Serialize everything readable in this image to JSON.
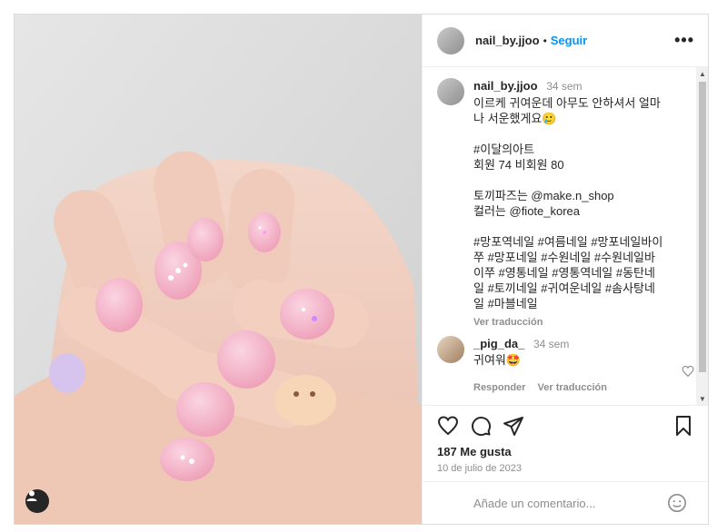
{
  "post": {
    "username": "nail_by.jjoo",
    "follow_label": "Seguir",
    "separator": "•",
    "more_label": "•••"
  },
  "caption": {
    "username": "nail_by.jjoo",
    "time": "34 sem",
    "text": "이르케 귀여운데 아무도 안하셔서 얼마\n나 서운했게요🥲\n\n#이달의아트\n회원 74 비회원 80\n\n토끼파즈는 @make.n_shop\n컬러는 @fiote_korea\n\n#망포역네일 #여름네일 #망포네일바이\n쭈 #망포네일 #수원네일 #수원네일바\n이쭈 #영통네일 #영통역네일 #동탄네\n일 #토끼네일 #귀여운네일 #솜사탕네\n일 #마블네일",
    "see_translation": "Ver traducción"
  },
  "comment": {
    "username": "_pig_da_",
    "time": "34 sem",
    "text": "귀여워🤩",
    "reply_label": "Responder",
    "see_translation": "Ver traducción"
  },
  "likes_text": "187 Me gusta",
  "date_text": "10 de julio de 2023",
  "add_comment_placeholder": "Añade un comentario...",
  "scrollbar": {
    "up": "▲",
    "down": "▼"
  },
  "colors": {
    "accent": "#0095f6",
    "muted": "#8e8e8e",
    "text": "#262626",
    "nail": "#f2b3c6"
  }
}
